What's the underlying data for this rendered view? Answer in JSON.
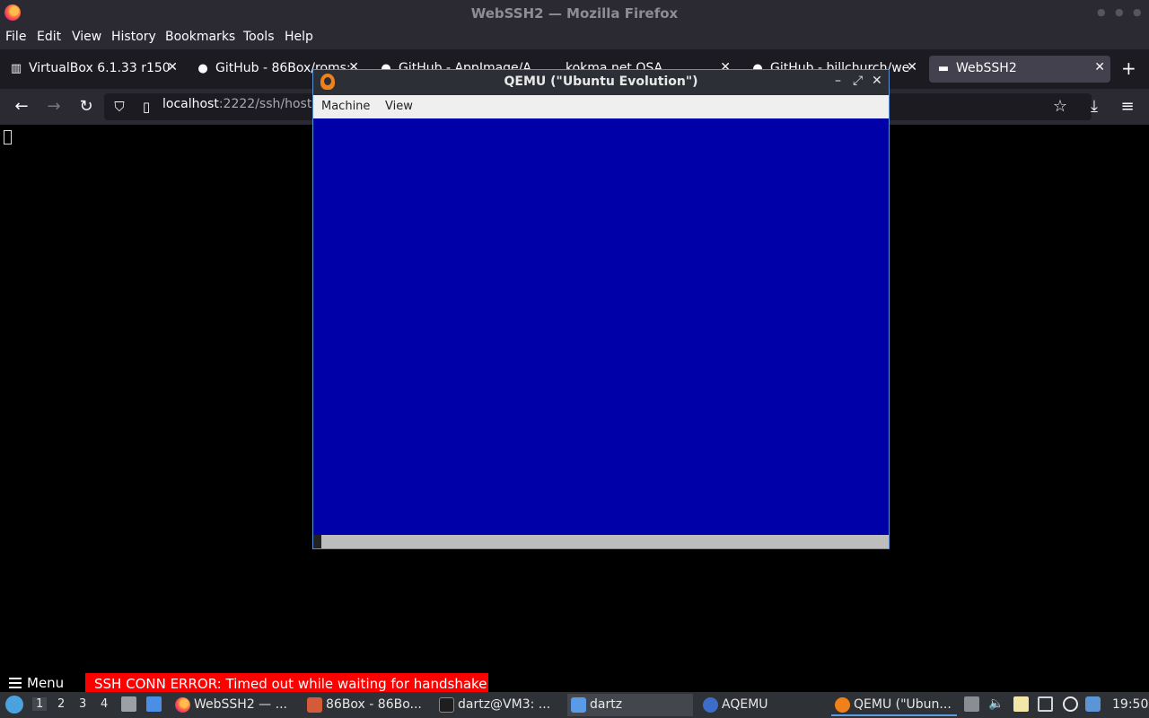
{
  "firefox": {
    "window_title": "WebSSH2 — Mozilla Firefox",
    "menu": [
      "File",
      "Edit",
      "View",
      "History",
      "Bookmarks",
      "Tools",
      "Help"
    ],
    "tabs": [
      {
        "label": "VirtualBox 6.1.33 r150",
        "icon": "virtualbox-icon",
        "active": false
      },
      {
        "label": "GitHub - 86Box/roms:",
        "icon": "github-icon",
        "active": false
      },
      {
        "label": "GitHub - AppImage/A",
        "icon": "github-icon",
        "active": false
      },
      {
        "label": "kokma.net OSA",
        "icon": "",
        "active": false
      },
      {
        "label": "GitHub - billchurch/we",
        "icon": "github-icon",
        "active": false
      },
      {
        "label": "WebSSH2",
        "icon": "terminal-icon",
        "active": true
      }
    ],
    "url_host": "localhost",
    "url_path": ":2222/ssh/host"
  },
  "qemu": {
    "title": "QEMU (\"Ubuntu Evolution\")",
    "menu": [
      "Machine",
      "View"
    ],
    "screen_color": "#0000a8"
  },
  "status": {
    "menu_label": "Menu",
    "ssh_error": "SSH CONN ERROR: Timed out while waiting for handshake"
  },
  "taskbar": {
    "workspaces": [
      "1",
      "2",
      "3",
      "4"
    ],
    "tasks": [
      {
        "label": "WebSSH2 — ...",
        "icon": "firefox-icon"
      },
      {
        "label": "86Box - 86Bo...",
        "icon": "86box-icon"
      },
      {
        "label": "dartz@VM3: ...",
        "icon": "terminal-icon"
      },
      {
        "label": "dartz",
        "icon": "folder-icon"
      },
      {
        "label": "AQEMU",
        "icon": "aqemu-icon"
      },
      {
        "label": "QEMU (\"Ubun...",
        "icon": "qemu-icon"
      }
    ],
    "clock": "19:50"
  }
}
